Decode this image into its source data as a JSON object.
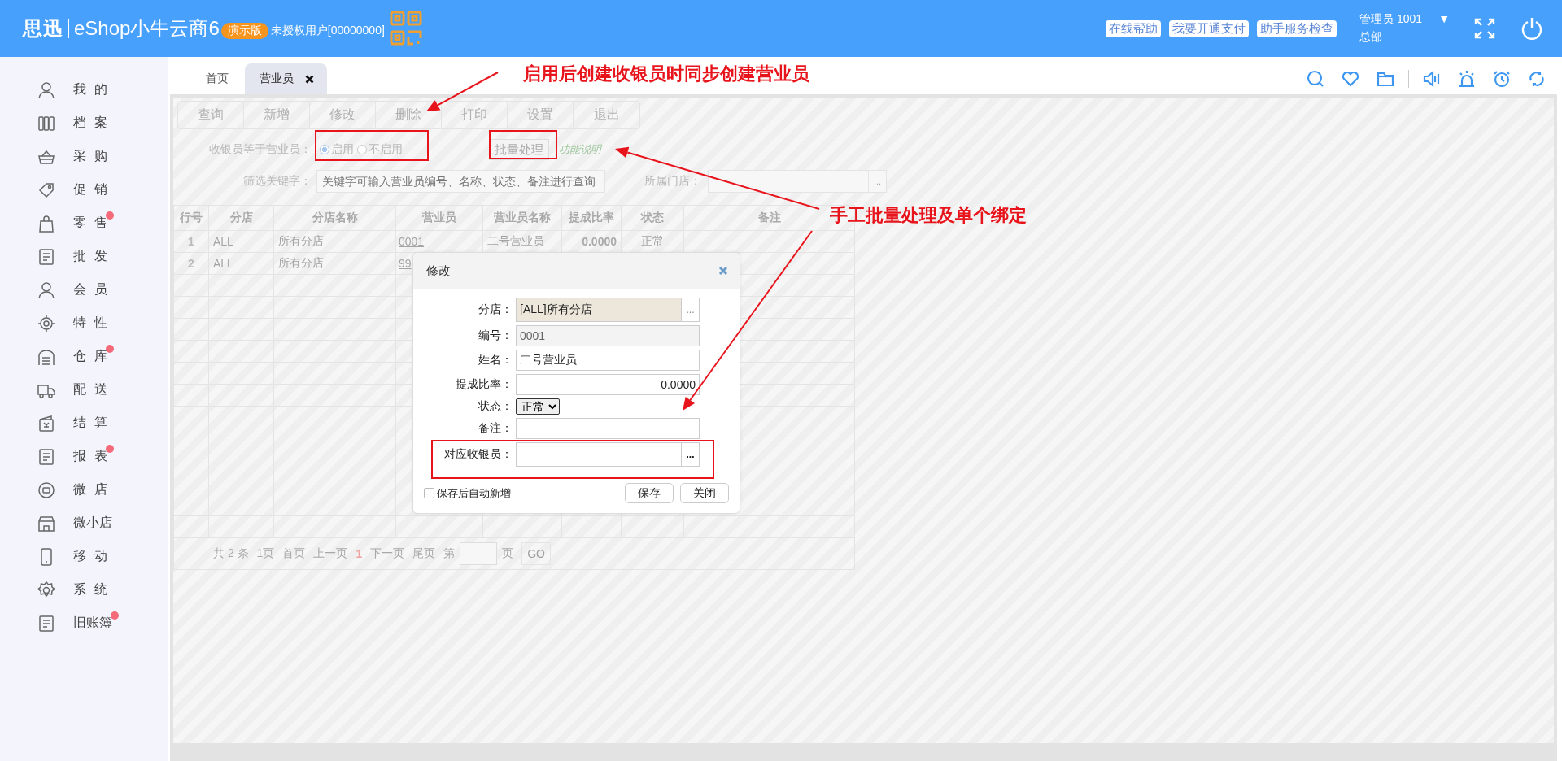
{
  "header": {
    "logo": "思迅",
    "product": "eShop小牛云商6",
    "edition_badge": "演示版",
    "license": "未授权用户[00000000]",
    "links": [
      "在线帮助",
      "我要开通支付",
      "助手服务检查"
    ],
    "user": "管理员 1001",
    "dropdown": "▼",
    "org": "总部"
  },
  "sidebar": {
    "items": [
      {
        "label": "我 的",
        "notification": false
      },
      {
        "label": "档 案",
        "notification": false
      },
      {
        "label": "采 购",
        "notification": false
      },
      {
        "label": "促 销",
        "notification": false
      },
      {
        "label": "零 售",
        "notification": true
      },
      {
        "label": "批 发",
        "notification": false
      },
      {
        "label": "会 员",
        "notification": false
      },
      {
        "label": "特 性",
        "notification": false
      },
      {
        "label": "仓 库",
        "notification": true
      },
      {
        "label": "配 送",
        "notification": false
      },
      {
        "label": "结 算",
        "notification": false
      },
      {
        "label": "报 表",
        "notification": true
      },
      {
        "label": "微 店",
        "notification": false
      },
      {
        "label": "微小店",
        "notification": false
      },
      {
        "label": "移 动",
        "notification": false
      },
      {
        "label": "系 统",
        "notification": false
      },
      {
        "label": "旧账簿",
        "notification": true
      }
    ]
  },
  "tabs": [
    {
      "label": "首页",
      "selected": false,
      "closable": false
    },
    {
      "label": "营业员",
      "selected": true,
      "closable": true
    }
  ],
  "toolbar": [
    "查询",
    "新增",
    "修改",
    "删除",
    "打印",
    "设置",
    "退出"
  ],
  "sync_setting": {
    "label": "收银员等于营业员：",
    "options": [
      {
        "label": "启用",
        "selected": true
      },
      {
        "label": "不启用",
        "selected": false
      }
    ]
  },
  "batch_button": "批量处理",
  "help_link": "功能说明",
  "filter": {
    "label": "筛选关键字：",
    "placeholder": "关键字可输入营业员编号、名称、状态、备注进行查询"
  },
  "store_filter": {
    "label": "所属门店：",
    "button": "..."
  },
  "table": {
    "columns": [
      "行号",
      "分店",
      "分店名称",
      "营业员",
      "营业员名称",
      "提成比率",
      "状态",
      "备注"
    ],
    "rows": [
      [
        "1",
        "ALL",
        "所有分店",
        "0001",
        "二号营业员",
        "0.0000",
        "正常"
      ],
      [
        "2",
        "ALL",
        "所有分店",
        "99"
      ]
    ]
  },
  "pager": {
    "total": "共 2 条",
    "pages": "1页",
    "first": "首页",
    "prev": "上一页",
    "current": "1",
    "next": "下一页",
    "last": "尾页",
    "goto_prefix": "第",
    "goto_suffix": "页",
    "go": "GO"
  },
  "dialog": {
    "title": "修改",
    "fields": [
      {
        "label": "分店：",
        "kind": "picker",
        "readonly": true,
        "value": "[ALL]所有分店",
        "button": "..."
      },
      {
        "label": "编号：",
        "kind": "text",
        "readonly": true,
        "value": "0001"
      },
      {
        "label": "姓名：",
        "kind": "text",
        "readonly": false,
        "value": "二号营业员"
      },
      {
        "label": "提成比率：",
        "kind": "number",
        "readonly": false,
        "value": "0.0000"
      },
      {
        "label": "状态：",
        "kind": "select",
        "value": "正常"
      },
      {
        "label": "备注：",
        "kind": "text",
        "readonly": false
      },
      {
        "label": "对应收银员：",
        "kind": "picker",
        "readonly": false,
        "button": "..."
      }
    ],
    "auto_new": {
      "label": "保存后自动新增",
      "checked": false
    },
    "buttons": [
      "保存",
      "关闭"
    ]
  },
  "annotations": [
    {
      "text": "启用后创建收银员时同步创建营业员"
    },
    {
      "text": "手工批量处理及单个绑定"
    }
  ]
}
